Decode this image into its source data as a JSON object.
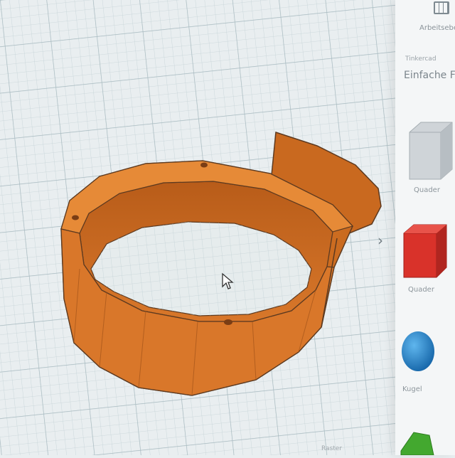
{
  "sidebar": {
    "workspace_label": "Arbeitsebe",
    "brand_label": "Tinkercad",
    "library_title": "Einfache For",
    "shapes": [
      {
        "label": "Quader",
        "color": "#cfd4d8",
        "icon": "box-icon"
      },
      {
        "label": "Quader",
        "color": "#d9322a",
        "icon": "box-icon"
      },
      {
        "label": "Kugel",
        "color": "#1e88d0",
        "icon": "sphere-icon"
      },
      {
        "label": "",
        "color": "#43a82f",
        "icon": "shape-icon"
      }
    ]
  },
  "viewport": {
    "model_color": "#e07d2a",
    "expand_icon": "chevron-right-icon",
    "bottom_label": "Raster"
  }
}
